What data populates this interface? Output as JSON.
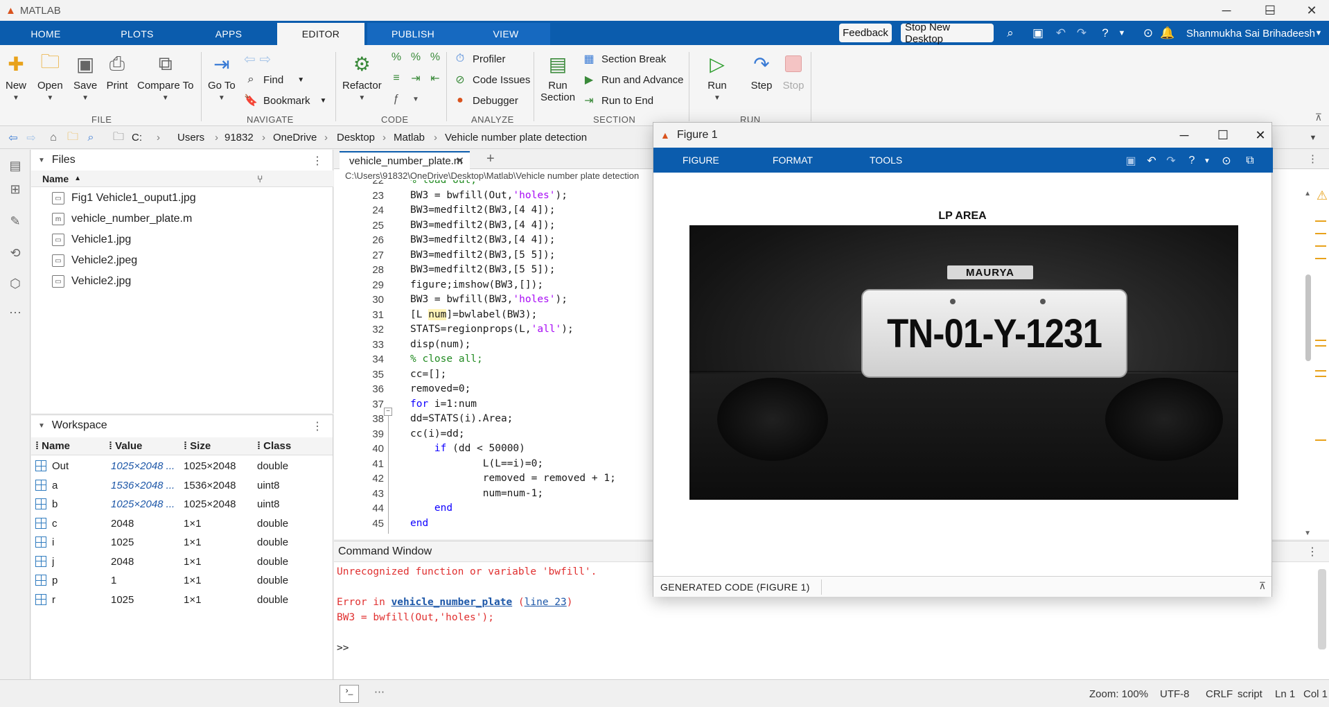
{
  "app": {
    "title": "MATLAB",
    "logo_icon": "matlab-logo-icon"
  },
  "tabs": [
    "HOME",
    "PLOTS",
    "APPS",
    "EDITOR",
    "PUBLISH",
    "VIEW"
  ],
  "active_tab": "EDITOR",
  "toolbar": {
    "feedback": "Feedback",
    "stop_new_desktop": "Stop New Desktop",
    "user": "Shanmukha Sai Brihadeesh"
  },
  "ribbon": {
    "file": {
      "label": "FILE",
      "new": "New",
      "open": "Open",
      "save": "Save",
      "print": "Print",
      "compare": "Compare To"
    },
    "navigate": {
      "label": "NAVIGATE",
      "goto": "Go To",
      "find": "Find",
      "bookmark": "Bookmark"
    },
    "code": {
      "label": "CODE",
      "refactor": "Refactor"
    },
    "analyze": {
      "label": "ANALYZE",
      "profiler": "Profiler",
      "code_issues": "Code Issues",
      "debugger": "Debugger"
    },
    "section": {
      "label": "SECTION",
      "run_section_1": "Run",
      "run_section_2": "Section",
      "section_break": "Section Break",
      "run_advance": "Run and Advance",
      "run_end": "Run to End"
    },
    "run": {
      "label": "RUN",
      "run": "Run",
      "step": "Step",
      "stop": "Stop"
    }
  },
  "address": {
    "crumbs": [
      "C:",
      "Users",
      "91832",
      "OneDrive",
      "Desktop",
      "Matlab",
      "Vehicle number plate detection"
    ]
  },
  "files": {
    "title": "Files",
    "col_name": "Name",
    "items": [
      "Fig1 Vehicle1_ouput1.jpg",
      "vehicle_number_plate.m",
      "Vehicle1.jpg",
      "Vehicle2.jpeg",
      "Vehicle2.jpg"
    ]
  },
  "workspace": {
    "title": "Workspace",
    "cols": [
      "Name",
      "Value",
      "Size",
      "Class"
    ],
    "rows": [
      {
        "name": "Out",
        "value": "1025×2048 ...",
        "size": "1025×2048",
        "class": "double"
      },
      {
        "name": "a",
        "value": "1536×2048 ...",
        "size": "1536×2048",
        "class": "uint8"
      },
      {
        "name": "b",
        "value": "1025×2048 ...",
        "size": "1025×2048",
        "class": "uint8"
      },
      {
        "name": "c",
        "value": "2048",
        "size": "1×1",
        "class": "double"
      },
      {
        "name": "i",
        "value": "1025",
        "size": "1×1",
        "class": "double"
      },
      {
        "name": "j",
        "value": "2048",
        "size": "1×1",
        "class": "double"
      },
      {
        "name": "p",
        "value": "1",
        "size": "1×1",
        "class": "double"
      },
      {
        "name": "r",
        "value": "1025",
        "size": "1×1",
        "class": "double"
      }
    ]
  },
  "editor": {
    "tab": "vehicle_number_plate.m",
    "path": "C:\\Users\\91832\\OneDrive\\Desktop\\Matlab\\Vehicle number plate detection",
    "lines": [
      {
        "n": "22",
        "text": "% load Out;"
      },
      {
        "n": "23",
        "text": "BW3 = bwfill(Out,'holes');"
      },
      {
        "n": "24",
        "text": "BW3=medfilt2(BW3,[4 4]);"
      },
      {
        "n": "25",
        "text": "BW3=medfilt2(BW3,[4 4]);"
      },
      {
        "n": "26",
        "text": "BW3=medfilt2(BW3,[4 4]);"
      },
      {
        "n": "27",
        "text": "BW3=medfilt2(BW3,[5 5]);"
      },
      {
        "n": "28",
        "text": "BW3=medfilt2(BW3,[5 5]);"
      },
      {
        "n": "29",
        "text": "figure;imshow(BW3,[]);"
      },
      {
        "n": "30",
        "text": "BW3 = bwfill(BW3,'holes');"
      },
      {
        "n": "31",
        "text": "[L num]=bwlabel(BW3);"
      },
      {
        "n": "32",
        "text": "STATS=regionprops(L,'all');"
      },
      {
        "n": "33",
        "text": "disp(num);"
      },
      {
        "n": "34",
        "text": "% close all;"
      },
      {
        "n": "35",
        "text": "cc=[];"
      },
      {
        "n": "36",
        "text": "removed=0;"
      },
      {
        "n": "37",
        "text": "for i=1:num"
      },
      {
        "n": "38",
        "text": "dd=STATS(i).Area;"
      },
      {
        "n": "39",
        "text": "cc(i)=dd;"
      },
      {
        "n": "40",
        "text": "    if (dd < 50000)"
      },
      {
        "n": "41",
        "text": "            L(L==i)=0;"
      },
      {
        "n": "42",
        "text": "            removed = removed + 1;"
      },
      {
        "n": "43",
        "text": "            num=num-1;"
      },
      {
        "n": "44",
        "text": "    end"
      },
      {
        "n": "45",
        "text": "end"
      }
    ]
  },
  "command_window": {
    "title": "Command Window",
    "err1": "Unrecognized function or variable 'bwfill'.",
    "err2_prefix": "Error in ",
    "err2_link": "vehicle_number_plate",
    "err2_paren_open": " (",
    "err2_line": "line 23",
    "err2_paren_close": ")",
    "err3": "BW3 = bwfill(Out,'holes');",
    "prompt": ">>"
  },
  "status": {
    "zoom": "Zoom: 100%",
    "encoding": "UTF-8",
    "eol": "CRLF",
    "type": "script",
    "ln": "Ln 1",
    "col": "Col 1"
  },
  "figure": {
    "title": "Figure 1",
    "tabs": [
      "FIGURE",
      "FORMAT",
      "TOOLS"
    ],
    "axes_title": "LP AREA",
    "plate_text": "TN-01-Y-1231",
    "badge_text": "MAURYA",
    "generated_code": "GENERATED CODE (FIGURE 1)"
  }
}
